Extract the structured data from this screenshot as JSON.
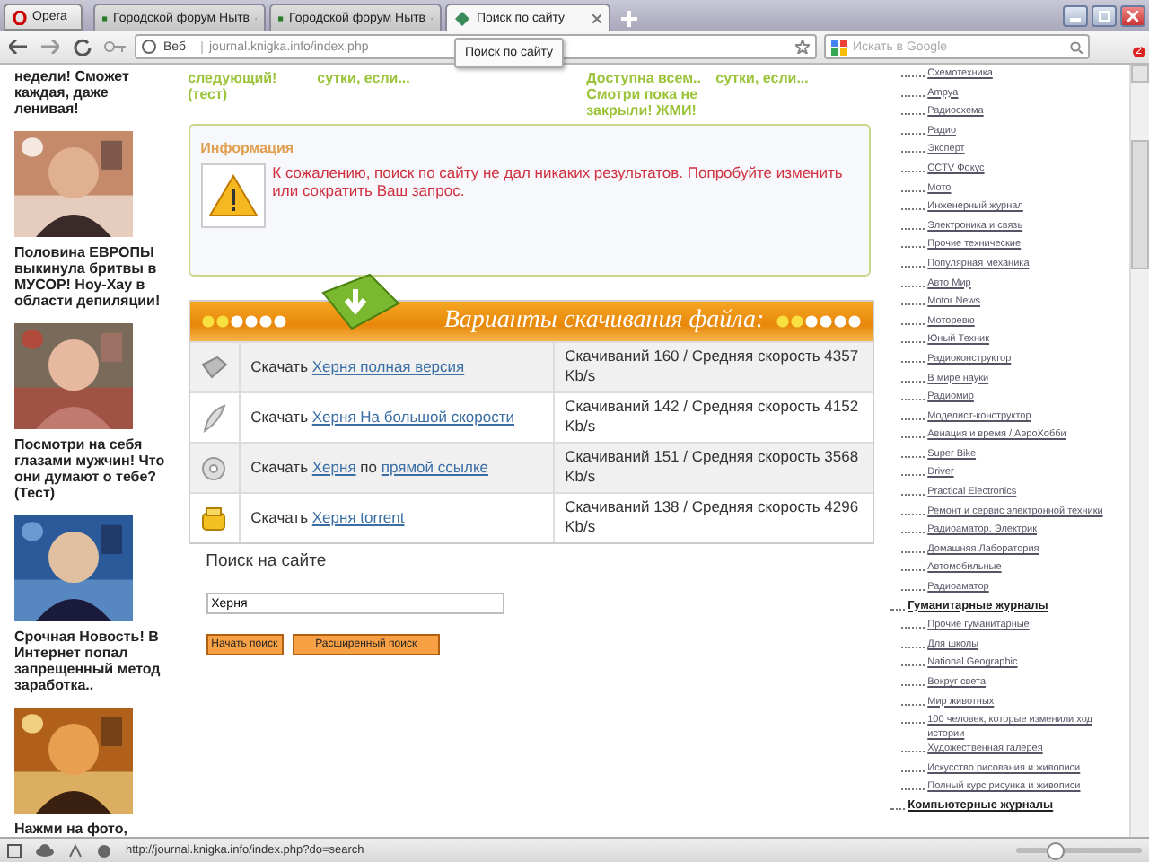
{
  "browser": {
    "menu_label": "Opera",
    "tabs": [
      {
        "title": "Городской форум Нытв",
        "selected": false
      },
      {
        "title": "Городской форум Нытв",
        "selected": false
      },
      {
        "title": "Поиск по сайту",
        "selected": true
      }
    ],
    "address_badge": "Веб",
    "address": "journal.knigka.info/index.php",
    "search_placeholder": "Искать в Google",
    "notification_count": "2",
    "tooltip": "Поиск по сайту"
  },
  "left_ads": {
    "lead_text": "недели! Сможет каждая, даже ленивая!",
    "items": [
      {
        "caption": "Половина ЕВРОПЫ выкинула бритвы в МУСОР! Ноу-Хау в области депиляции!"
      },
      {
        "caption": "Посмотри на себя глазами мужчин! Что они думают о тебе? (Тест)"
      },
      {
        "caption": "Срочная Новость! В Интернет попал запрещенный метод заработка.."
      },
      {
        "caption": "Нажми на фото,"
      }
    ]
  },
  "top_ads": [
    {
      "text": "следующий! (тест)"
    },
    {
      "text": "сутки, если..."
    },
    {
      "text": "Доступна всем.. Смотри пока не закрыли! ЖМИ!"
    },
    {
      "text": "сутки, если..."
    }
  ],
  "info": {
    "title": "Информация",
    "message": "К сожалению, поиск по сайту не дал никаких результатов. Попробуйте изменить или сократить Ваш запрос."
  },
  "downloads": {
    "title": "Варианты скачивания файла:",
    "rows": [
      {
        "kind": "full",
        "parts": [
          {
            "text": "Скачать ",
            "link": false
          },
          {
            "text": "Херня полная версия",
            "link": true
          }
        ],
        "stats": "Скачиваний 160 / Средняя скорость 4357 Kb/s"
      },
      {
        "kind": "fast",
        "parts": [
          {
            "text": "Скачать ",
            "link": false
          },
          {
            "text": "Херня На большой скорости",
            "link": true
          }
        ],
        "stats": "Скачиваний 142 / Средняя скорость 4152 Kb/s"
      },
      {
        "kind": "direct",
        "parts": [
          {
            "text": "Скачать ",
            "link": false
          },
          {
            "text": "Херня",
            "link": true
          },
          {
            "text": " по ",
            "link": false
          },
          {
            "text": "прямой ссылке",
            "link": true
          }
        ],
        "stats": "Скачиваний 151 / Средняя скорость 3568 Kb/s"
      },
      {
        "kind": "torrent",
        "parts": [
          {
            "text": "Скачать ",
            "link": false
          },
          {
            "text": "Херня torrent",
            "link": true
          }
        ],
        "stats": "Скачиваний 138 / Средняя скорость 4296 Kb/s"
      }
    ]
  },
  "search": {
    "label": "Поиск на сайте",
    "value": "Херня",
    "buttons": [
      "Начать поиск",
      "Расширенный поиск"
    ]
  },
  "catalog": [
    {
      "children": [
        "Схемотехника",
        "Ampya",
        "Радиосхема",
        "Радио",
        "Эксперт",
        "CCTV Фокус",
        "Мото",
        "Инженерный журнал",
        "Электроника и связь",
        "Прочие технические",
        "Популярная механика",
        "Авто Мир",
        "Motor News",
        "Моторевю",
        "Юный Техник",
        "Радиоконструктор",
        "В мире науки",
        "Радиомир",
        "Моделист-конструктор",
        "Авиация и время / АэроХобби",
        "Super Bike",
        "Driver",
        "Practical Electronics",
        "Ремонт и сервис электронной техники",
        "Радиоаматор. Электрик",
        "Домашняя Лаборатория",
        "Автомобильные",
        "Радиоаматор"
      ]
    },
    {
      "title": "Гуманитарные журналы",
      "children": [
        "Прочие гуманитарные",
        "Для школы",
        "National Geographic",
        "Вокруг света",
        "Мир животных",
        "100 человек, которые изменили ход истории",
        "Художественная галерея",
        "Искусство рисования и живописи",
        "Полный курс рисунка и живописи"
      ]
    },
    {
      "title": "Компьютерные журналы"
    }
  ],
  "status_bar": {
    "url": "http://journal.knigka.info/index.php?do=search",
    "zoom": {
      "level": 0.3
    }
  }
}
